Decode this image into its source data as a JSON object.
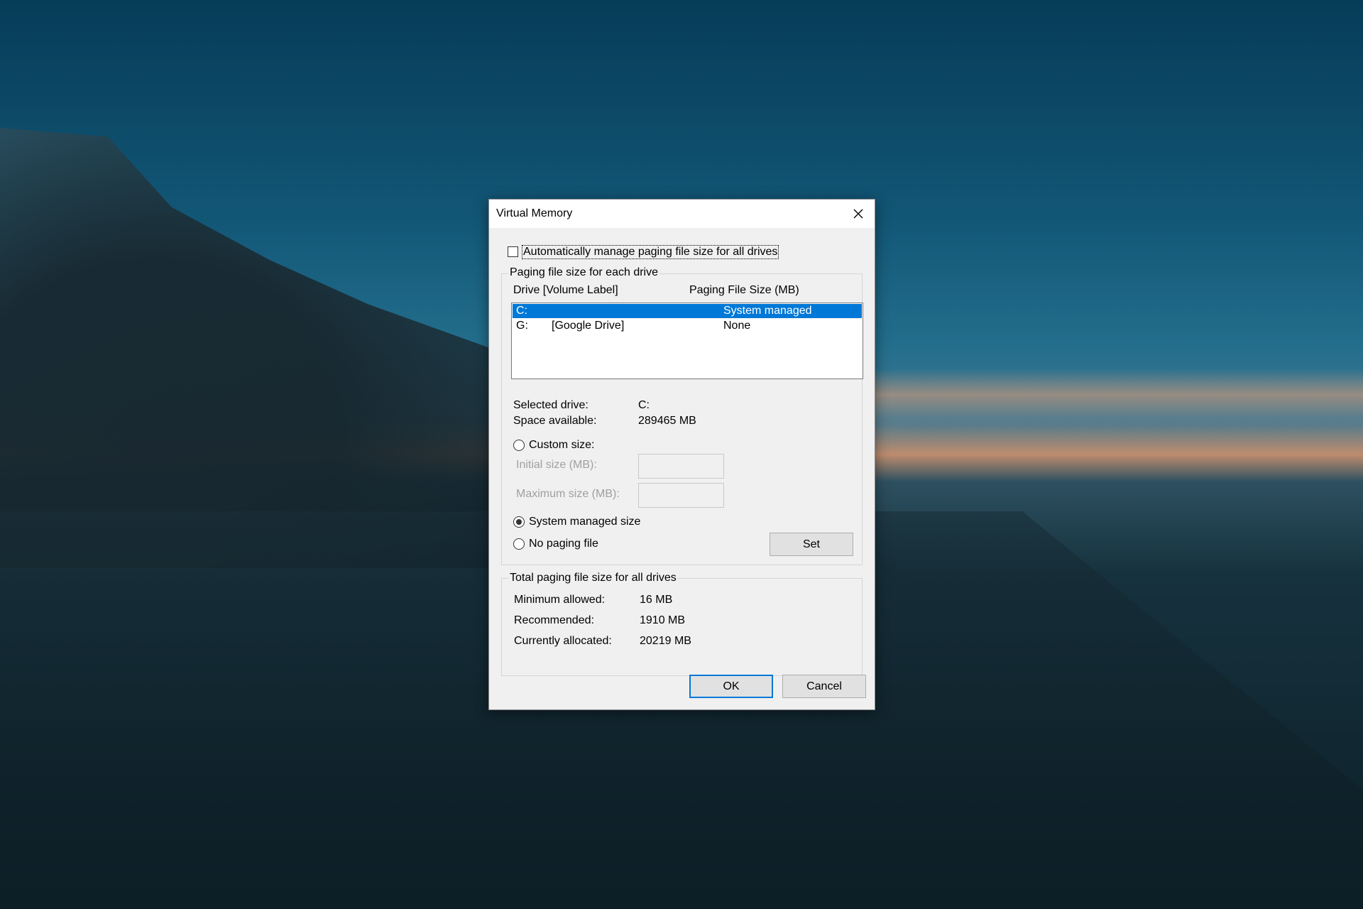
{
  "dialog": {
    "title": "Virtual Memory",
    "auto_manage_label": "Automatically manage paging file size for all drives",
    "auto_manage_checked": false
  },
  "paging_group": {
    "legend": "Paging file size for each drive",
    "col_drive": "Drive  [Volume Label]",
    "col_size": "Paging File Size (MB)",
    "rows": [
      {
        "drive": "C:",
        "label": "",
        "size": "System managed",
        "selected": true
      },
      {
        "drive": "G:",
        "label": "[Google Drive]",
        "size": "None",
        "selected": false
      }
    ],
    "selected_drive_label": "Selected drive:",
    "selected_drive_value": "C:",
    "space_available_label": "Space available:",
    "space_available_value": "289465 MB",
    "custom_size_label": "Custom size:",
    "initial_size_label": "Initial size (MB):",
    "initial_size_value": "",
    "maximum_size_label": "Maximum size (MB):",
    "maximum_size_value": "",
    "system_managed_label": "System managed size",
    "no_paging_label": "No paging file",
    "selected_option": "system_managed",
    "set_button": "Set"
  },
  "total_group": {
    "legend": "Total paging file size for all drives",
    "minimum_label": "Minimum allowed:",
    "minimum_value": "16 MB",
    "recommended_label": "Recommended:",
    "recommended_value": "1910 MB",
    "current_label": "Currently allocated:",
    "current_value": "20219 MB"
  },
  "buttons": {
    "ok": "OK",
    "cancel": "Cancel"
  },
  "icons": {
    "close": "close-icon"
  },
  "colors": {
    "accent": "#0078d7",
    "dialog_bg": "#f0f0f0"
  }
}
